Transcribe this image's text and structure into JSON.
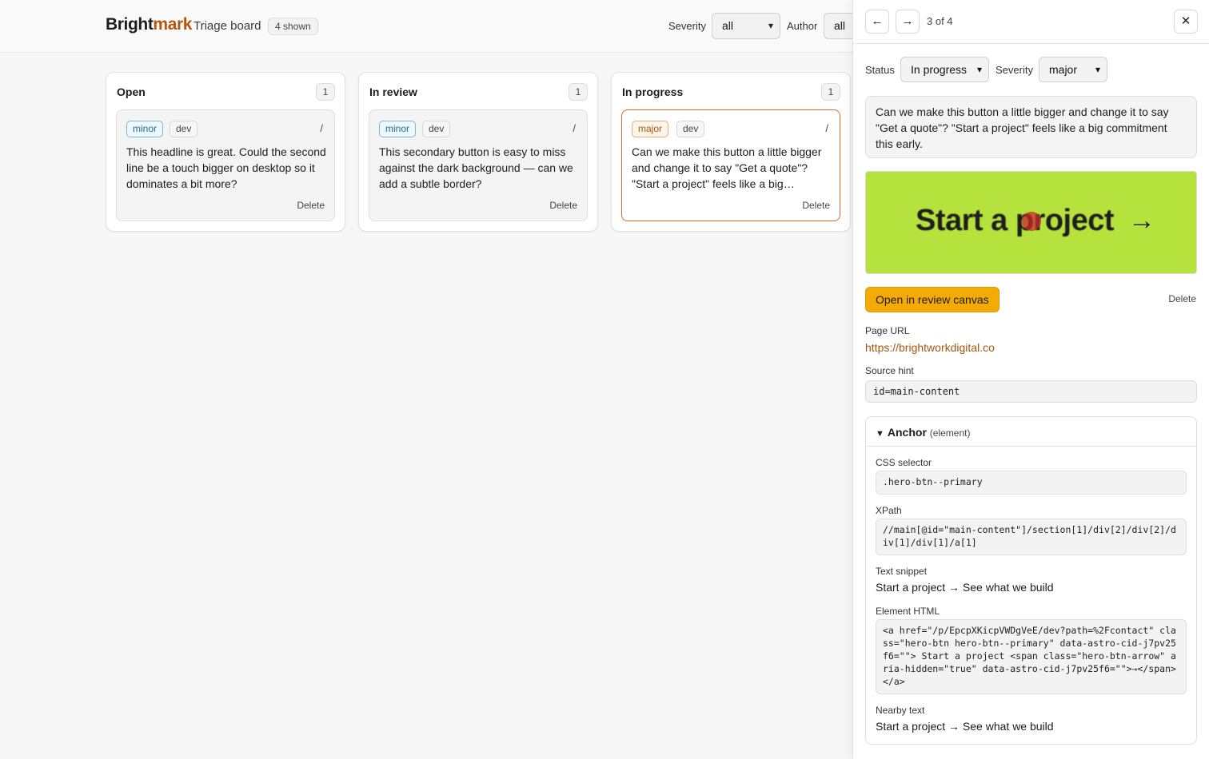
{
  "header": {
    "brand_part1": "Bright",
    "brand_part2": "mark",
    "title": "Triage board",
    "shown_badge": "4 shown",
    "severity_label": "Severity",
    "severity_value": "all",
    "author_label": "Author",
    "author_value": "all"
  },
  "columns": [
    {
      "title": "Open",
      "count": "1",
      "card": {
        "severity": "minor",
        "author": "dev",
        "slash": "/",
        "text": "This headline is great. Could the second line be a touch bigger on desktop so it dominates a bit more?",
        "delete": "Delete"
      }
    },
    {
      "title": "In review",
      "count": "1",
      "card": {
        "severity": "minor",
        "author": "dev",
        "slash": "/",
        "text": "This secondary button is easy to miss against the dark background — can we add a subtle border?",
        "delete": "Delete"
      }
    },
    {
      "title": "In progress",
      "count": "1",
      "card": {
        "severity": "major",
        "author": "dev",
        "slash": "/",
        "text": "Can we make this button a little bigger and change it to say \"Get a quote\"? \"Start a project\" feels like a big…",
        "delete": "Delete"
      }
    }
  ],
  "panel": {
    "prev_icon": "←",
    "next_icon": "→",
    "pager": "3 of 4",
    "close_icon": "✕",
    "status_label": "Status",
    "status_value": "In progress",
    "severity_label": "Severity",
    "severity_value": "major",
    "comment": "Can we make this button a little bigger and change it to say \"Get a quote\"? \"Start a project\" feels like a big commitment this early.",
    "screenshot_text": "Start a project",
    "screenshot_arrow": "→",
    "open_canvas": "Open in review canvas",
    "delete": "Delete",
    "page_url_label": "Page URL",
    "page_url": "https://brightworkdigital.co",
    "source_hint_label": "Source hint",
    "source_hint": "id=main-content",
    "anchor": {
      "title": "Anchor",
      "subtitle": "(element)",
      "css_label": "CSS selector",
      "css": ".hero-btn--primary",
      "xpath_label": "XPath",
      "xpath": "//main[@id=\"main-content\"]/section[1]/div[2]/div[2]/div[1]/div[1]/a[1]",
      "snippet_label": "Text snippet",
      "snippet": "Start a project → See what we build",
      "html_label": "Element HTML",
      "html": "<a href=\"/p/EpcpXKicpVWDgVeE/dev?path=%2Fcontact\" class=\"hero-btn hero-btn--primary\" data-astro-cid-j7pv25f6=\"\"> Start a project <span class=\"hero-btn-arrow\" aria-hidden=\"true\" data-astro-cid-j7pv25f6=\"\">→</span> </a>",
      "nearby_label": "Nearby text",
      "nearby": "Start a project → See what we build"
    }
  },
  "colors": {
    "brand_accent": "#b5560f",
    "primary_button": "#f5ab07",
    "minor_tag": "#1a6f9a",
    "major_tag": "#a75612",
    "screenshot_bg": "#b6e23d"
  }
}
